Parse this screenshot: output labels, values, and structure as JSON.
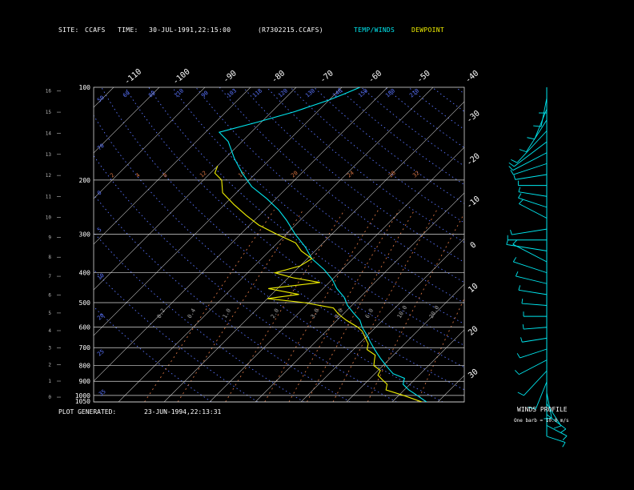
{
  "header": {
    "site_label": "SITE:",
    "site_value": "CCAFS",
    "time_label": "TIME:",
    "time_value": "30-JUL-1991,22:15:00",
    "file_id": "(R7302215.CCAFS)",
    "legend_temp": "TEMP/WINDS",
    "legend_dew": "DEWPOINT"
  },
  "footer": {
    "generated_label": "PLOT GENERATED:",
    "generated_value": "23-JUN-1994,22:13:31"
  },
  "wind_panel": {
    "title": "WINDS PROFILE",
    "note": "One barb = 10.0 m/s"
  },
  "colors": {
    "background": "#000000",
    "isobars": "#d8d8d8",
    "isotherms": "#c8c8c8",
    "dry_adiabats": "#5a74ff",
    "mixing_ratio": "#d07040",
    "temperature": "#00e8f0",
    "dewpoint": "#f0f000"
  },
  "chart_data": {
    "type": "line",
    "chart_kind": "Skew-T log-P thermodynamic diagram",
    "pressure_levels_mb": [
      "100",
      "200",
      "300",
      "400",
      "500",
      "600",
      "700",
      "800",
      "900",
      "1000",
      "1050"
    ],
    "height_ticks_km": [
      "0",
      "1",
      "2",
      "3",
      "4",
      "5",
      "6",
      "7",
      "8",
      "9",
      "10",
      "11",
      "12",
      "13",
      "14",
      "15",
      "16"
    ],
    "isotherm_labels_top": [
      "-110",
      "-100",
      "-90",
      "-80",
      "-70",
      "-60",
      "-50",
      "-40"
    ],
    "isotherm_labels_right": [
      "-30",
      "-20",
      "-10",
      "0",
      "10",
      "20",
      "30"
    ],
    "dry_adiabat_labels": [
      "50",
      "60",
      "80",
      "110",
      "90",
      "103",
      "118",
      "120",
      "130",
      "140",
      "150",
      "180",
      "210"
    ],
    "mixing_ratio_labels_top": [
      "2",
      "4",
      "8",
      "12",
      "16",
      "20",
      "24",
      "28",
      "32"
    ],
    "mixing_ratio_labels_low": [
      "0.2",
      "0.4",
      "1.0",
      "2.0",
      "3.0",
      "4.0",
      "6.0",
      "10.0",
      "20.0"
    ],
    "series": [
      {
        "name": "TEMP/WINDS",
        "pressure_mb": [
          1050,
          1000,
          960,
          920,
          880,
          850,
          820,
          790,
          760,
          730,
          700,
          670,
          640,
          600,
          570,
          540,
          510,
          480,
          450,
          420,
          390,
          360,
          330,
          300,
          270,
          250,
          230,
          210,
          190,
          170,
          150,
          140,
          130,
          120,
          110,
          105,
          100
        ],
        "temp_c": [
          27.5,
          24,
          21,
          18.5,
          17.5,
          14,
          12,
          10,
          8,
          6,
          4,
          2,
          0,
          -3,
          -5,
          -8,
          -11,
          -13.5,
          -17,
          -20,
          -24,
          -29,
          -33,
          -38,
          -43,
          -47,
          -52,
          -58,
          -63,
          -68,
          -73,
          -77,
          -71,
          -65,
          -60,
          -58,
          -56
        ]
      },
      {
        "name": "DEWPOINT",
        "pressure_mb": [
          1050,
          1000,
          960,
          920,
          890,
          860,
          830,
          800,
          770,
          740,
          710,
          680,
          650,
          620,
          600,
          570,
          545,
          520,
          500,
          485,
          470,
          450,
          430,
          415,
          400,
          380,
          360,
          340,
          320,
          300,
          280,
          260,
          240,
          220,
          200,
          190,
          180
        ],
        "dewp_c": [
          26.5,
          21,
          16,
          15,
          13,
          11,
          10.5,
          8,
          7,
          6,
          3,
          2,
          0,
          -2,
          -4,
          -8,
          -11,
          -13.5,
          -21,
          -30,
          -24,
          -32,
          -22,
          -29,
          -34,
          -30,
          -29,
          -33,
          -36,
          -42,
          -48,
          -53,
          -58,
          -63,
          -66,
          -69,
          -70
        ]
      }
    ],
    "wind_profile": {
      "note": "One barb = 10.0 m/s",
      "direction_deg": [
        110,
        120,
        130,
        150,
        170,
        200,
        220,
        240,
        250,
        260,
        265,
        270,
        275,
        280,
        285,
        290,
        300,
        280,
        270,
        260,
        300,
        290,
        280,
        270,
        260,
        250,
        240,
        230,
        220,
        210,
        200,
        190,
        180
      ],
      "speed_ms": [
        3,
        5,
        6,
        8,
        8,
        10,
        12,
        10,
        8,
        6,
        5,
        5,
        6,
        8,
        10,
        12,
        14,
        15,
        14,
        12,
        10,
        9,
        8,
        8,
        10,
        12,
        14,
        16,
        18,
        15,
        12,
        10,
        8
      ]
    },
    "grid": true
  }
}
